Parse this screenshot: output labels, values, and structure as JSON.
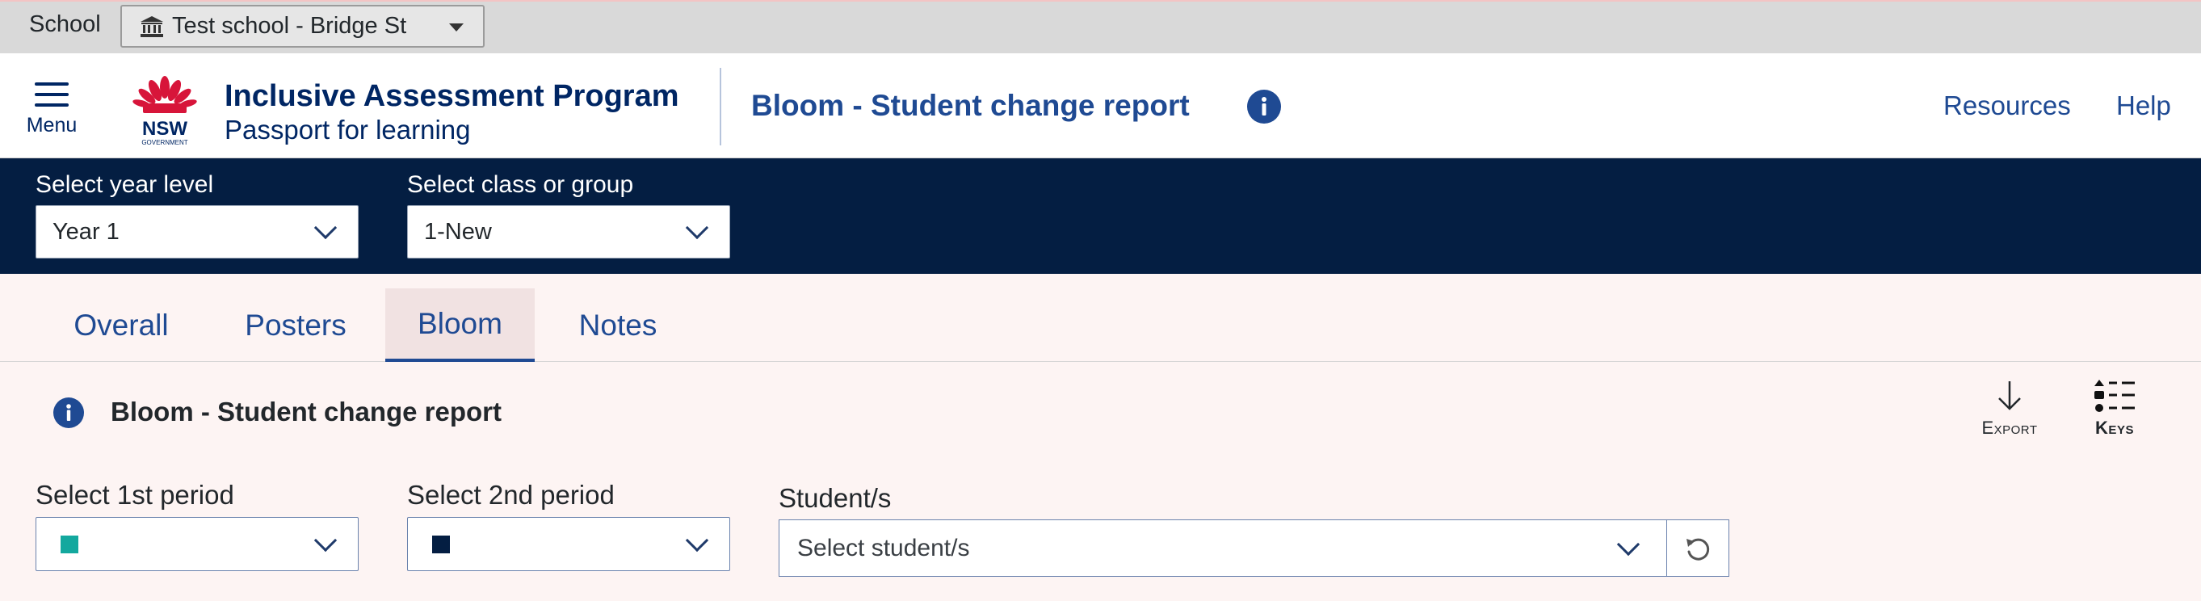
{
  "school_bar": {
    "label": "School",
    "selected_school": "Test school - Bridge St",
    "icon": "bank-icon"
  },
  "header": {
    "menu_label": "Menu",
    "logo": "nsw-government-logo",
    "logo_text": "NSW",
    "logo_subtext": "GOVERNMENT",
    "app_title": "Inclusive Assessment Program",
    "app_subtitle": "Passport for learning",
    "report_title": "Bloom - Student change report",
    "nav": [
      {
        "label": "Resources"
      },
      {
        "label": "Help"
      }
    ]
  },
  "filters": {
    "year_label": "Select year level",
    "year_value": "Year 1",
    "class_label": "Select class or group",
    "class_value": "1-New"
  },
  "tabs": [
    {
      "label": "Overall",
      "active": false
    },
    {
      "label": "Posters",
      "active": false
    },
    {
      "label": "Bloom",
      "active": true
    },
    {
      "label": "Notes",
      "active": false
    }
  ],
  "content": {
    "title": "Bloom - Student change report",
    "export_label": "Export",
    "keys_label": "Keys",
    "period1_label": "Select 1st period",
    "period1_color": "#13a89e",
    "period2_label": "Select 2nd period",
    "period2_color": "#041e42",
    "students_label": "Student/s",
    "students_placeholder": "Select student/s"
  },
  "colors": {
    "brand_navy": "#041e42",
    "link_blue": "#1f4a93",
    "nsw_red": "#d7153a"
  }
}
